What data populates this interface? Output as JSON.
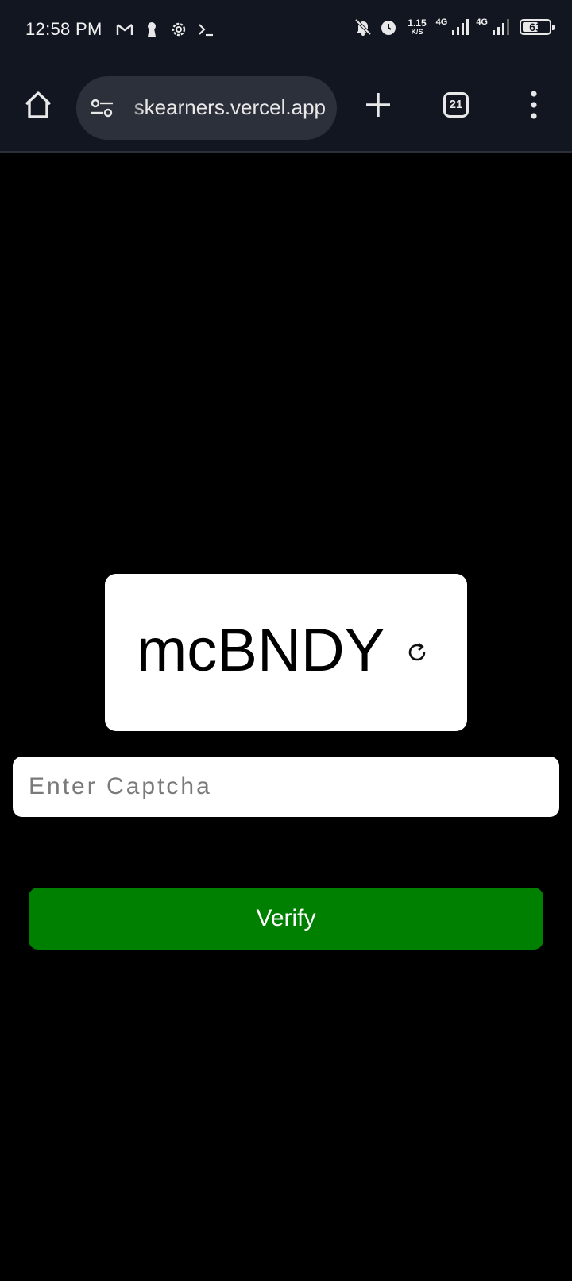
{
  "status_bar": {
    "time": "12:58 PM",
    "left_icons": [
      "gmail-icon",
      "keyhole-icon",
      "settings-icon",
      "terminal-icon"
    ],
    "right_icons": [
      "bell-off-icon",
      "alarm-icon"
    ],
    "net_speed_value": "1.15",
    "net_speed_unit": "K/S",
    "sim1_label": "4G",
    "sim2_label": "4G",
    "battery_percent": 63,
    "battery_text": "63"
  },
  "toolbar": {
    "url": "skearners.vercel.app",
    "tab_count": "21",
    "icons": [
      "home-icon",
      "site-settings-icon",
      "new-tab-icon",
      "tab-switcher-icon",
      "more-menu-icon"
    ]
  },
  "captcha": {
    "code": "mcBNDY",
    "refresh_icon": "refresh-icon",
    "input_placeholder": "Enter Captcha",
    "input_value": ""
  },
  "verify": {
    "label": "Verify"
  },
  "colors": {
    "chrome_background": "#121620",
    "url_pill": "#2c303a",
    "page_background": "#000000",
    "card_background": "#ffffff",
    "verify_button": "#008000"
  }
}
